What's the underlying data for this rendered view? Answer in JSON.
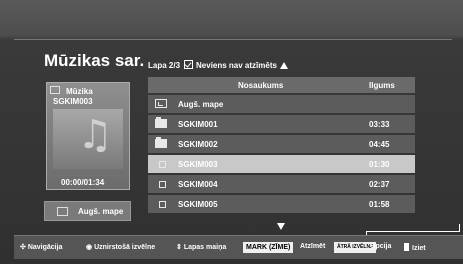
{
  "title": "Mūzikas sar.",
  "page_info": {
    "page": "Lapa 2/3",
    "none_marked": "Neviens nav atzīmēts"
  },
  "preview": {
    "header": "Mūzika",
    "file": "SGKIM003",
    "time": "00:00/01:34",
    "art_icon": "music-note-icon"
  },
  "up_button": {
    "label": "Augš. mape"
  },
  "table": {
    "col_name": "Nosaukums",
    "col_duration": "Ilgums",
    "rows": [
      {
        "icon": "up-folder",
        "name": "Augš. mape",
        "duration": ""
      },
      {
        "icon": "folder",
        "name": "SGKIM001",
        "duration": "03:33"
      },
      {
        "icon": "folder",
        "name": "SGKIM002",
        "duration": "04:45"
      },
      {
        "icon": "file",
        "name": "SGKIM003",
        "duration": "01:30",
        "selected": true
      },
      {
        "icon": "file",
        "name": "SGKIM004",
        "duration": "02:37"
      },
      {
        "icon": "file",
        "name": "SGKIM005",
        "duration": "01:58"
      }
    ]
  },
  "footer": {
    "navigation": "Navigācija",
    "select": "Uznirstošā izvēlne",
    "page_change": "Lapas maiņa",
    "mark_badge": "MARK (ZĪME)",
    "mark": "Atzīmēt",
    "quick_badge": "ĀTRĀ IZVĒLNE",
    "option": "Opcija",
    "exit": "Iziet"
  },
  "colors": {
    "background": "#303030",
    "row": "#5c5c5c",
    "selected_row": "#c8c8c8",
    "header": "#6a6a6a"
  }
}
